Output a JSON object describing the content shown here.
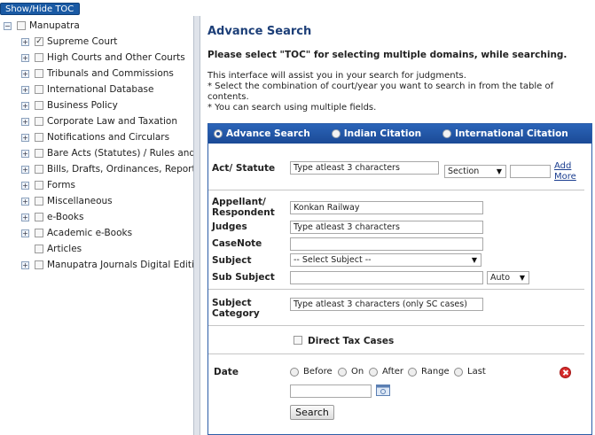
{
  "toc_toggle": "Show/Hide TOC",
  "toc": {
    "root": "Manupatra",
    "items": [
      {
        "label": "Supreme Court",
        "checked": true,
        "expander": true
      },
      {
        "label": "High Courts and Other Courts",
        "checked": false,
        "expander": true
      },
      {
        "label": "Tribunals and Commissions",
        "checked": false,
        "expander": true
      },
      {
        "label": "International Database",
        "checked": false,
        "expander": true
      },
      {
        "label": "Business Policy",
        "checked": false,
        "expander": true
      },
      {
        "label": "Corporate Law and Taxation",
        "checked": false,
        "expander": true
      },
      {
        "label": "Notifications and Circulars",
        "checked": false,
        "expander": true
      },
      {
        "label": "Bare Acts (Statutes) / Rules and R",
        "checked": false,
        "expander": true
      },
      {
        "label": "Bills, Drafts, Ordinances, Reports",
        "checked": false,
        "expander": true
      },
      {
        "label": "Forms",
        "checked": false,
        "expander": true
      },
      {
        "label": "Miscellaneous",
        "checked": false,
        "expander": true
      },
      {
        "label": "e-Books",
        "checked": false,
        "expander": true
      },
      {
        "label": "Academic e-Books",
        "checked": false,
        "expander": true
      },
      {
        "label": "Articles",
        "checked": false,
        "expander": false
      },
      {
        "label": "Manupatra Journals Digital Edition",
        "checked": false,
        "expander": true
      }
    ]
  },
  "main": {
    "title": "Advance Search",
    "notice": "Please select  \"TOC\"  for selecting multiple domains, while searching.",
    "info": [
      "This interface will assist you in your search for judgments.",
      "* Select the combination of court/year you want to search in from the table of contents.",
      "* You can search using multiple fields."
    ]
  },
  "form": {
    "tabs": [
      "Advance Search",
      "Indian Citation",
      "International Citation"
    ],
    "act_label": "Act/ Statute",
    "act_placeholder": "Type atleast 3 characters",
    "section_select": "Section",
    "section_value": "",
    "add_more": [
      "Add",
      "More"
    ],
    "appellant_label": [
      "Appellant/",
      "Respondent"
    ],
    "appellant_value": "Konkan Railway",
    "judges_label": "Judges",
    "judges_placeholder": "Type atleast 3 characters",
    "casenote_label": "CaseNote",
    "casenote_value": "",
    "subject_label": "Subject",
    "subject_select": "-- Select Subject --",
    "subsubject_label": "Sub Subject",
    "subsubject_value": "",
    "auto_select": "Auto",
    "category_label": [
      "Subject",
      "Category"
    ],
    "category_placeholder": "Type atleast 3 characters (only SC cases)",
    "direct_tax_label": "Direct Tax Cases",
    "date_label": "Date",
    "date_options": [
      "Before",
      "On",
      "After",
      "Range",
      "Last"
    ],
    "date_value": "",
    "search_button": "Search"
  },
  "colors": {
    "header_blue": "#1b4a96",
    "title_blue": "#1d3f78",
    "delete_red": "#d62b2b"
  }
}
